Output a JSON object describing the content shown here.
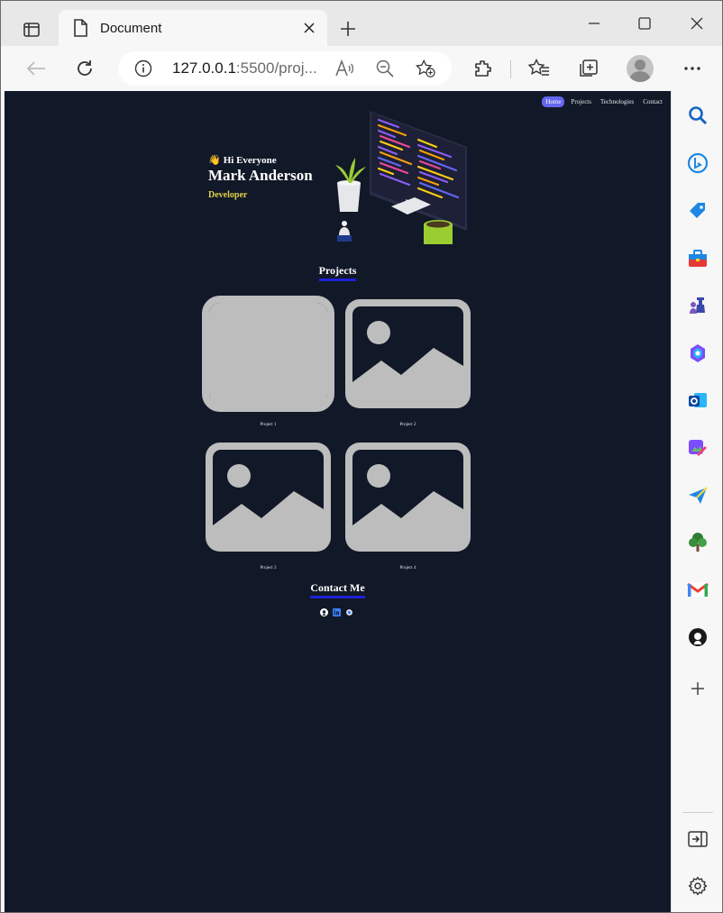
{
  "browser": {
    "tab_title": "Document",
    "url_host": "127.0.0.1",
    "url_rest": ":5500/proj..."
  },
  "page": {
    "nav": {
      "items": [
        "Home",
        "Projects",
        "Technologies",
        "Contact"
      ],
      "active": "Home"
    },
    "hero": {
      "greeting_emoji": "👋",
      "greeting": "Hi Everyone",
      "name": "Mark Anderson",
      "role": "Developer"
    },
    "projects": {
      "title": "Projects",
      "items": [
        {
          "caption": "Project 1"
        },
        {
          "caption": "Project 2"
        },
        {
          "caption": "Project 3"
        },
        {
          "caption": "Project 4"
        }
      ]
    },
    "contact": {
      "title": "Contact Me",
      "links": [
        "github-icon",
        "linkedin-icon",
        "chrome-icon"
      ]
    }
  },
  "colors": {
    "page_bg": "#111827",
    "accent_nav": "#6366f1",
    "underline": "#1d22d8",
    "role_text": "#e0d24a",
    "placeholder": "#bdbdbd"
  },
  "sidebar_icons": [
    "search-icon",
    "bing-chat-icon",
    "shopping-tag-icon",
    "tools-icon",
    "games-icon",
    "copilot-icon",
    "outlook-icon",
    "designer-icon",
    "send-icon",
    "tree-icon",
    "gmail-icon",
    "github-icon",
    "add-icon",
    "sidebar-toggle-icon",
    "settings-icon"
  ]
}
